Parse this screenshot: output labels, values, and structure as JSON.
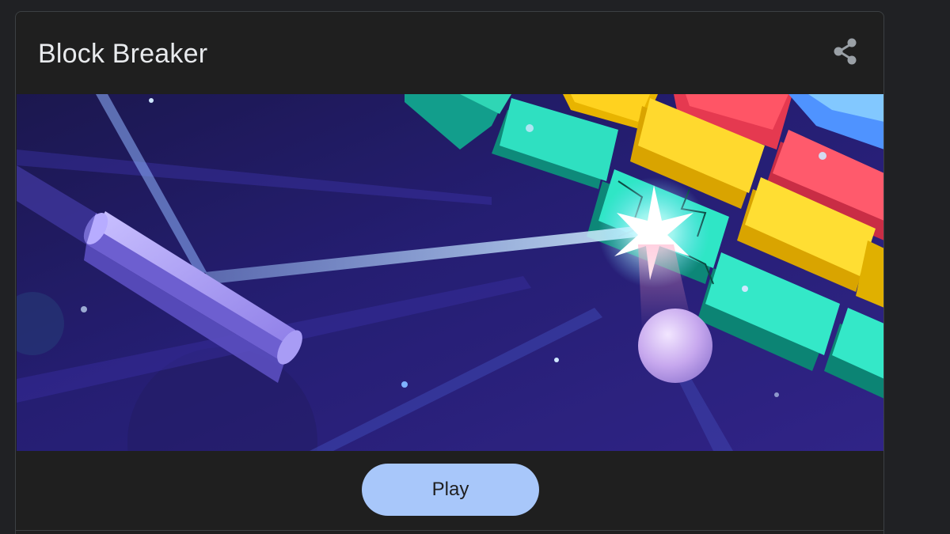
{
  "card": {
    "title": "Block Breaker",
    "share_icon": "share-icon",
    "banner_image": "block-breaker-game-illustration",
    "play_label": "Play"
  },
  "colors": {
    "background": "#1f1f1f",
    "title_text": "#e8eaed",
    "play_button": "#a8c7fa",
    "play_text": "#1f1f1f",
    "border": "#3c4043"
  }
}
